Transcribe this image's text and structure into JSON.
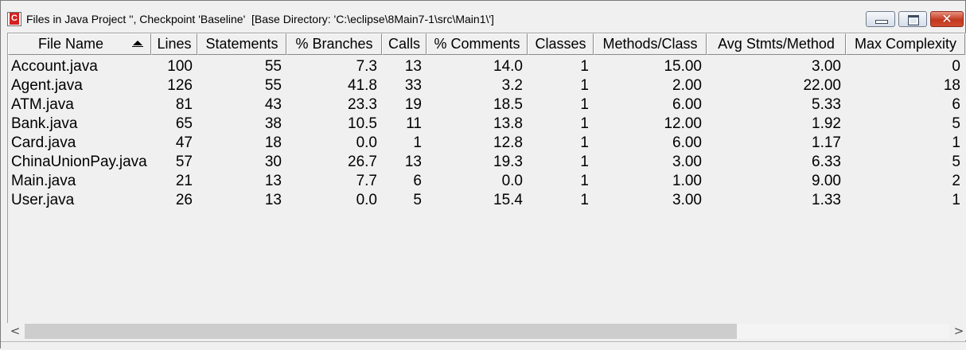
{
  "window": {
    "title": "Files in Java Project '', Checkpoint 'Baseline'  [Base Directory: 'C:\\eclipse\\8Main7-1\\src\\Main1\\']",
    "icon": "c-icon",
    "close_glyph": "✕"
  },
  "table": {
    "columns": [
      "File Name",
      "Lines",
      "Statements",
      "% Branches",
      "Calls",
      "% Comments",
      "Classes",
      "Methods/Class",
      "Avg Stmts/Method",
      "Max Complexity"
    ],
    "sort_column": "File Name",
    "sort_direction": "ascending",
    "rows": [
      [
        "Account.java",
        "100",
        "55",
        "7.3",
        "13",
        "14.0",
        "1",
        "15.00",
        "3.00",
        "0"
      ],
      [
        "Agent.java",
        "126",
        "55",
        "41.8",
        "33",
        "3.2",
        "1",
        "2.00",
        "22.00",
        "18"
      ],
      [
        "ATM.java",
        "81",
        "43",
        "23.3",
        "19",
        "18.5",
        "1",
        "6.00",
        "5.33",
        "6"
      ],
      [
        "Bank.java",
        "65",
        "38",
        "10.5",
        "11",
        "13.8",
        "1",
        "12.00",
        "1.92",
        "5"
      ],
      [
        "Card.java",
        "47",
        "18",
        "0.0",
        "1",
        "12.8",
        "1",
        "6.00",
        "1.17",
        "1"
      ],
      [
        "ChinaUnionPay.java",
        "57",
        "30",
        "26.7",
        "13",
        "19.3",
        "1",
        "3.00",
        "6.33",
        "5"
      ],
      [
        "Main.java",
        "21",
        "13",
        "7.7",
        "6",
        "0.0",
        "1",
        "1.00",
        "9.00",
        "2"
      ],
      [
        "User.java",
        "26",
        "13",
        "0.0",
        "5",
        "15.4",
        "1",
        "3.00",
        "1.33",
        "1"
      ]
    ]
  },
  "scrollbar": {
    "left_arrow": "<",
    "right_arrow": ">",
    "thumb_fraction": 0.77
  }
}
